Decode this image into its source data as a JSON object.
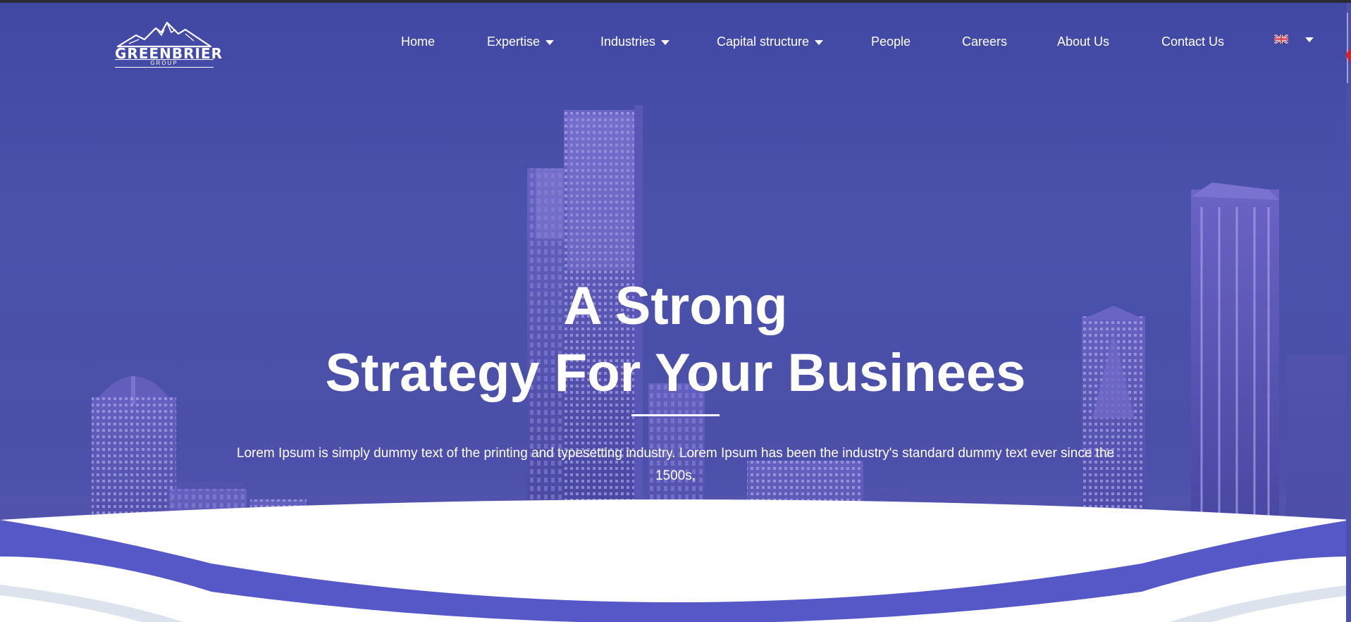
{
  "logo": {
    "name": "GREENBRIER",
    "sub": "GROUP"
  },
  "nav": {
    "home": "Home",
    "expertise": "Expertise",
    "industries": "Industries",
    "capital_structure": "Capital structure",
    "people": "People",
    "careers": "Careers",
    "about": "About Us",
    "contact": "Contact Us"
  },
  "hero": {
    "title_line1": "A Strong",
    "title_line2": "Strategy For Your Businees",
    "description": "Lorem Ipsum is simply dummy text of the printing and typesetting industry. Lorem Ipsum has been the industry's standard dummy text ever since the 1500s,"
  },
  "icons": {
    "logo": "mountain-logo-icon",
    "dropdown": "caret-down-icon",
    "language": "uk-flag-icon"
  },
  "colors": {
    "hero_overlay": "#4a4fa8",
    "wave_accent": "#5658c8",
    "wave_light": "#dde3ec",
    "text": "#ffffff"
  }
}
